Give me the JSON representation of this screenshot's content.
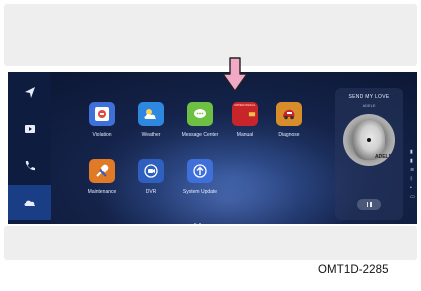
{
  "sidebar": {
    "items": [
      {
        "icon": "navigation-arrow-icon"
      },
      {
        "icon": "media-play-icon"
      },
      {
        "icon": "phone-icon"
      },
      {
        "icon": "cloud-icon",
        "active": true
      }
    ]
  },
  "apps": [
    {
      "label": "Violation",
      "icon": "violation-icon",
      "color": "#3f6fd8"
    },
    {
      "label": "Weather",
      "icon": "weather-icon",
      "color": "#2f88e0"
    },
    {
      "label": "Message Center",
      "icon": "message-icon",
      "color": "#6dc042"
    },
    {
      "label": "Manual",
      "icon": "manual-icon",
      "color": "#c8252a",
      "tile_text": "OWNER MANUAL"
    },
    {
      "label": "Diagnose",
      "icon": "diagnose-icon",
      "color": "#d88c2a"
    },
    {
      "label": "Maintenance",
      "icon": "maintenance-icon",
      "color": "#e07a27"
    },
    {
      "label": "DVR",
      "icon": "dvr-icon",
      "color": "#2f5fbf"
    },
    {
      "label": "System Update",
      "icon": "system-update-icon",
      "color": "#3f6fd8"
    }
  ],
  "media": {
    "song_title": "SEND MY LOVE",
    "artist": "ADELE",
    "album_text": "ADELE",
    "pause_icon": "pause-icon"
  },
  "caption": {
    "code": "OMT1D-2285"
  },
  "colors": {
    "pointer_arrow": "#f2a9c6",
    "active_sidebar": "#1a3e86"
  }
}
